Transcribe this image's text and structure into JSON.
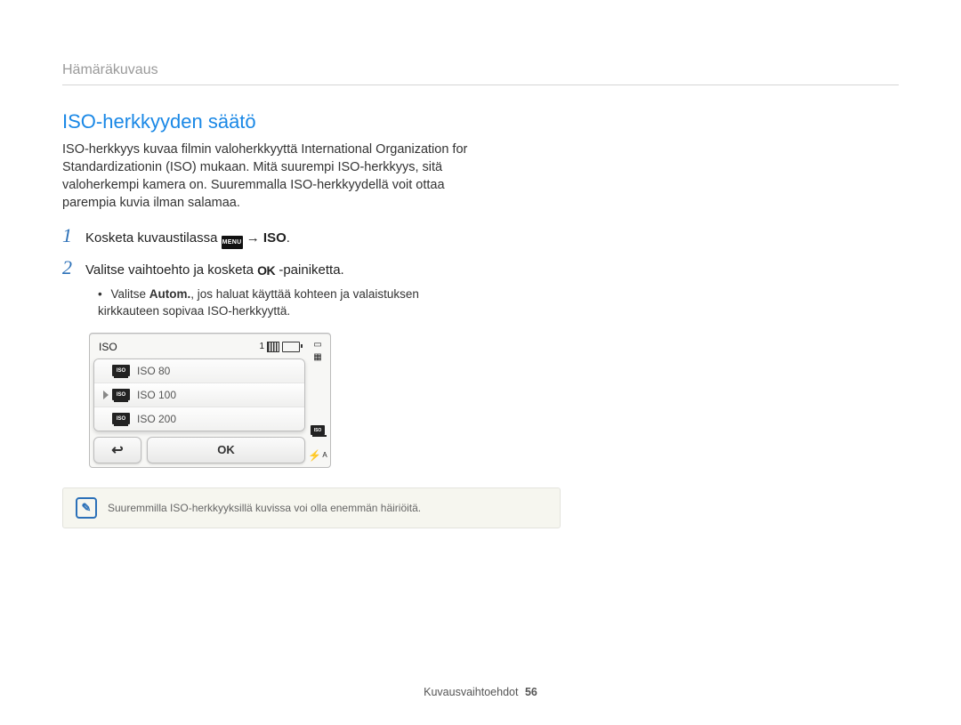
{
  "section_label": "Hämäräkuvaus",
  "heading": "ISO-herkkyyden säätö",
  "intro": "ISO-herkkyys kuvaa filmin valoherkkyyttä International Organization for Standardizationin (ISO) mukaan. Mitä suurempi ISO-herkkyys, sitä valoherkempi kamera on. Suuremmalla ISO-herkkyydellä voit ottaa parempia kuvia ilman salamaa.",
  "steps": {
    "s1_prefix": "Kosketa kuvaustilassa ",
    "s1_menu": "MENU",
    "s1_arrow": "→",
    "s1_suffix": "ISO",
    "s1_period": ".",
    "s2_prefix": "Valitse vaihtoehto ja kosketa ",
    "s2_ok": "OK",
    "s2_suffix": " -painiketta."
  },
  "bullet": {
    "prefix": "Valitse ",
    "bold": "Autom.",
    "rest": ", jos haluat käyttää kohteen ja valaistuksen kirkkauteen sopivaa ISO-herkkyyttä."
  },
  "screen": {
    "title": "ISO",
    "page_indicator": "1",
    "items": [
      "ISO 80",
      "ISO 100",
      "ISO 200"
    ],
    "selected_index": 1,
    "ok_label": "OK"
  },
  "note": "Suuremmilla ISO-herkkyyksillä kuvissa voi olla enemmän häiriöitä.",
  "footer": {
    "label": "Kuvausvaihtoehdot",
    "page": "56"
  }
}
